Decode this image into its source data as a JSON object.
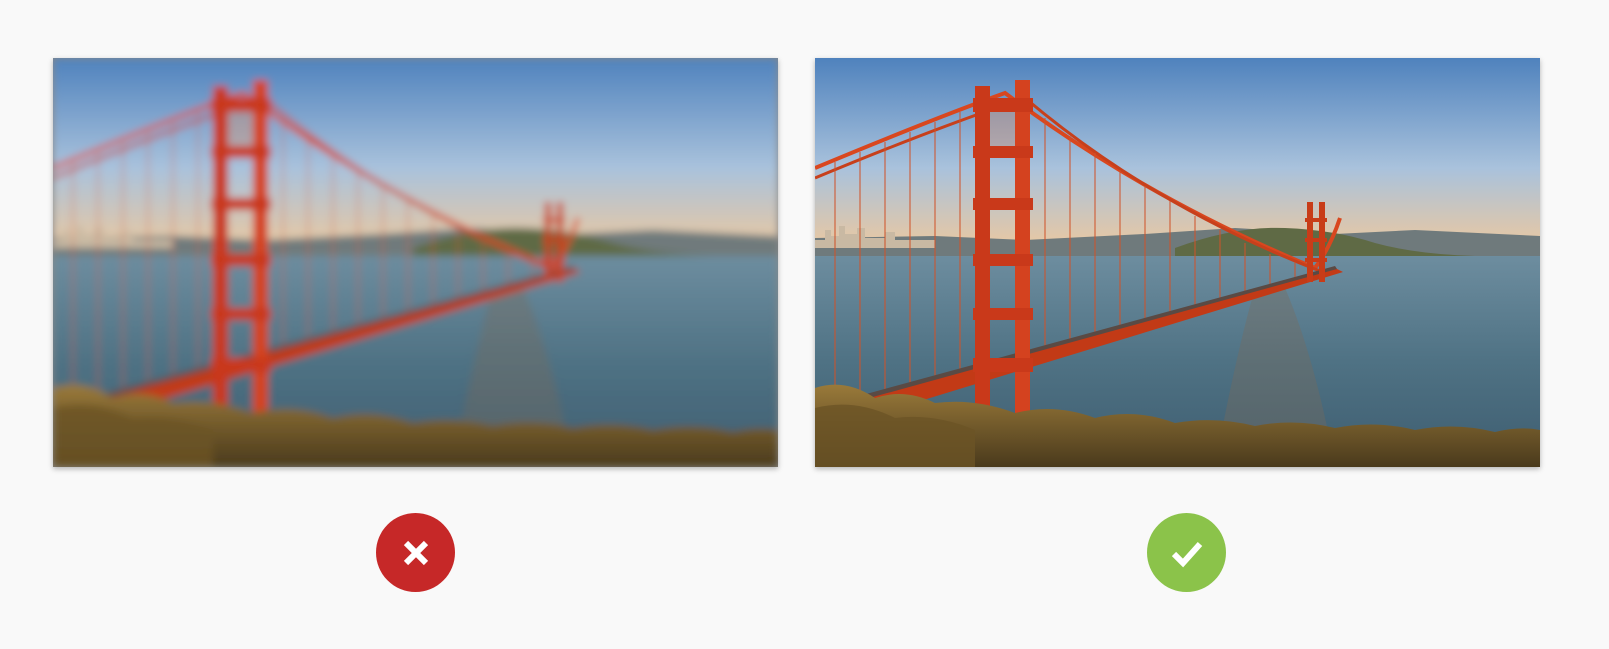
{
  "comparison": {
    "left": {
      "image_icon": "golden-gate-bridge-photo",
      "state": "blurred",
      "status_icon": "cross-icon",
      "status_color": "#c62828"
    },
    "right": {
      "image_icon": "golden-gate-bridge-photo",
      "state": "sharp",
      "status_icon": "check-icon",
      "status_color": "#8bc34a"
    }
  }
}
